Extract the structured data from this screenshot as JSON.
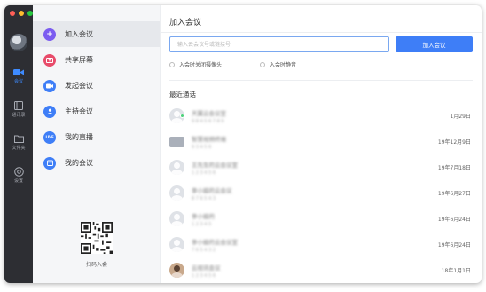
{
  "rail": {
    "items": [
      {
        "label": "会议",
        "icon": "video-camera-icon",
        "active": true
      },
      {
        "label": "通讯录",
        "icon": "contacts-icon",
        "active": false
      },
      {
        "label": "文件夹",
        "icon": "folder-icon",
        "active": false
      },
      {
        "label": "设置",
        "icon": "settings-icon",
        "active": false
      }
    ]
  },
  "menu": {
    "items": [
      {
        "label": "加入会议",
        "icon": "plus-icon",
        "active": true
      },
      {
        "label": "共享屏幕",
        "icon": "share-screen-icon",
        "active": false
      },
      {
        "label": "发起会议",
        "icon": "video-start-icon",
        "active": false
      },
      {
        "label": "主持会议",
        "icon": "host-icon",
        "active": false
      },
      {
        "label": "我的直播",
        "icon": "live-icon",
        "badge_text": "LIVE",
        "active": false
      },
      {
        "label": "我的会议",
        "icon": "calendar-icon",
        "active": false
      }
    ],
    "qr_label": "扫码入会"
  },
  "main": {
    "title": "加入会议",
    "join_input_placeholder": "输入云会议号或链接号",
    "join_button_label": "加入会议",
    "options": [
      {
        "label": "入会时关闭摄像头",
        "checked": false
      },
      {
        "label": "入会时静音",
        "checked": false
      }
    ],
    "recent_title": "最近通话",
    "calls": [
      {
        "name": "天翼云会议室",
        "sub": "9 8 4 5 6 7 8 9",
        "date": "1月29日",
        "avatar": "person",
        "online": true
      },
      {
        "name": "智慧视频终端",
        "sub": "9 3 4 5 6",
        "date": "19年12月9日",
        "avatar": "screen",
        "online": false
      },
      {
        "name": "王先生的云会议室",
        "sub": "1 2 3 4 5 6",
        "date": "19年7月18日",
        "avatar": "person",
        "online": false
      },
      {
        "name": "李小姐的云会议",
        "sub": "8 7 6 5 4 3",
        "date": "19年6月27日",
        "avatar": "person",
        "online": false
      },
      {
        "name": "李小姐的",
        "sub": "1 2 3 4 5",
        "date": "19年6月24日",
        "avatar": "person",
        "online": false
      },
      {
        "name": "李小姐的云会议室",
        "sub": "7 6 5 4 3 2",
        "date": "19年6月24日",
        "avatar": "person",
        "online": false
      },
      {
        "name": "云视讯会议",
        "sub": "1 2 3 4 5 6",
        "date": "18年1月1日",
        "avatar": "photo",
        "online": false
      }
    ]
  },
  "colors": {
    "accent": "#3e7ef7",
    "rail_bg": "#2d2e33",
    "menu_bg": "#f5f6f8",
    "online": "#4cd07a"
  }
}
